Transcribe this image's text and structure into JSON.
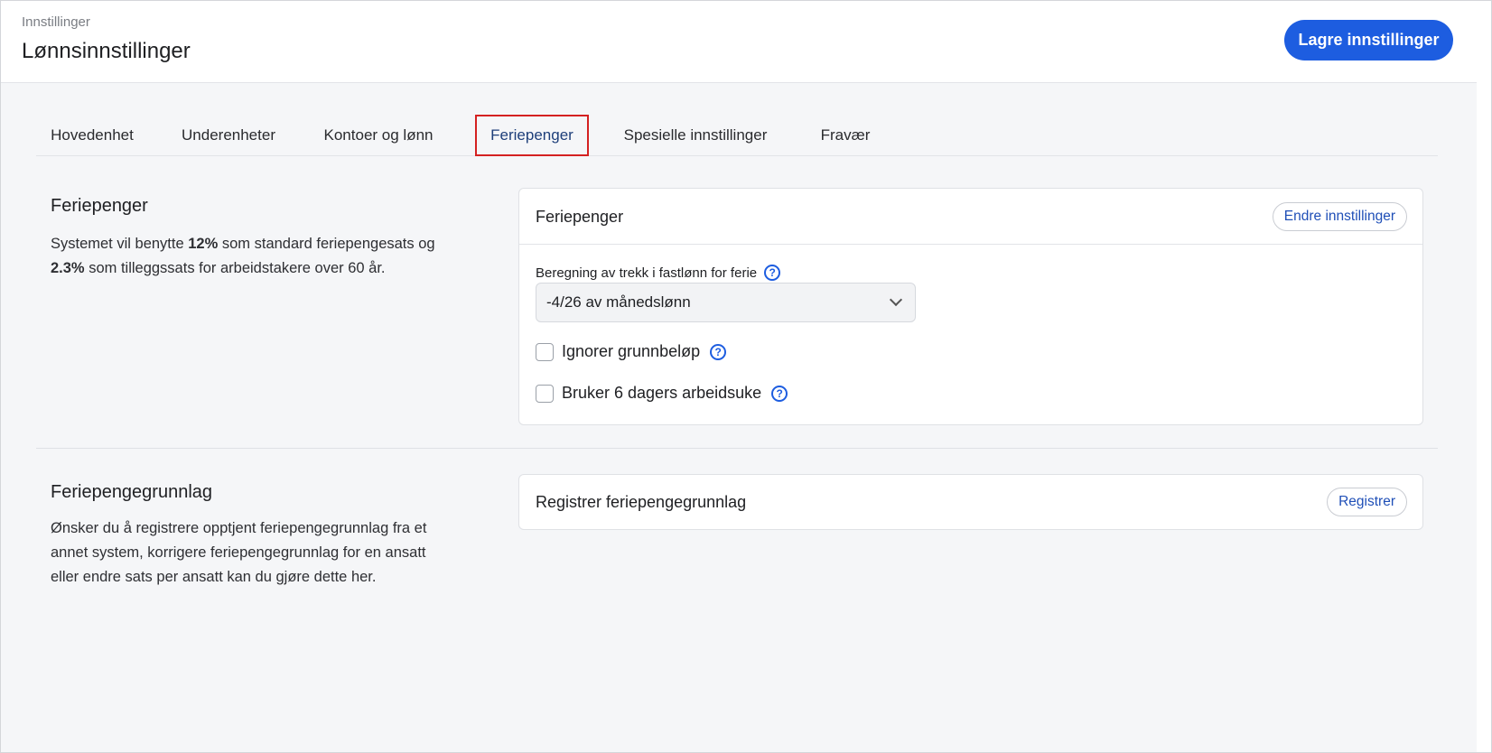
{
  "header": {
    "breadcrumb": "Innstillinger",
    "title": "Lønnsinnstillinger",
    "save_label": "Lagre innstillinger"
  },
  "tabs": [
    {
      "label": "Hovedenhet",
      "active": false
    },
    {
      "label": "Underenheter",
      "active": false
    },
    {
      "label": "Kontoer og lønn",
      "active": false
    },
    {
      "label": "Feriepenger",
      "active": true
    },
    {
      "label": "Spesielle innstillinger",
      "active": false
    },
    {
      "label": "Fravær",
      "active": false
    }
  ],
  "feriepenger_section": {
    "title": "Feriepenger",
    "desc_part1": "Systemet vil benytte ",
    "rate_standard": "12%",
    "desc_part2": " som standard feriepengesats og ",
    "rate_extra": "2.3%",
    "desc_part3": " som tilleggssats for arbeidstakere over 60 år.",
    "card": {
      "title": "Feriepenger",
      "edit_label": "Endre innstillinger",
      "field_label": "Beregning av trekk i fastlønn for ferie",
      "select_value": "-4/26 av månedslønn",
      "checkbox_1": "Ignorer grunnbeløp",
      "checkbox_2": "Bruker 6 dagers arbeidsuke"
    }
  },
  "grunnlag_section": {
    "title": "Feriepengegrunnlag",
    "desc": "Ønsker du å registrere opptjent feriepengegrunnlag fra et annet system, korrigere feriepengegrunnlag for en ansatt eller endre sats per ansatt kan du gjøre dette her.",
    "card": {
      "title": "Registrer feriepengegrunnlag",
      "register_label": "Registrer"
    }
  },
  "icons": {
    "help": "question-circle-icon",
    "chevron": "chevron-down-icon"
  },
  "colors": {
    "primary": "#1d5de0",
    "active_tab_border": "#d42121"
  }
}
